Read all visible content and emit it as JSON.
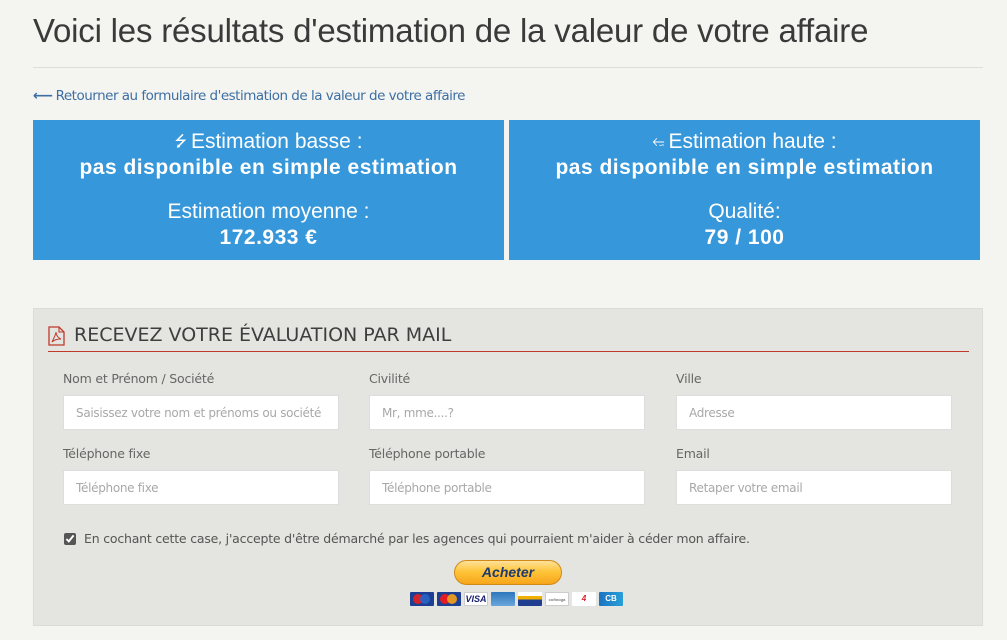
{
  "header": {
    "title": "Voici les résultats d'estimation de la valeur de votre affaire",
    "back_link": "Retourner au formulaire d'estimation de la valeur de votre affaire",
    "back_icon": "long-arrow-left-icon"
  },
  "estimates": {
    "low": {
      "icon": "double-chevron-down-icon",
      "label": "Estimation basse :",
      "value": "pas disponible en simple estimation"
    },
    "high": {
      "icon": "double-chevron-up-icon",
      "label": "Estimation haute :",
      "value": "pas disponible en simple estimation"
    },
    "average": {
      "label": "Estimation moyenne :",
      "value": "172.933 €"
    },
    "quality": {
      "label": "Qualité:",
      "value": "79 / 100"
    },
    "box_color": "#3697da"
  },
  "mail_form": {
    "icon": "pdf-file-icon",
    "title": "RECEVEZ VOTRE ÉVALUATION PAR MAIL",
    "accent_color": "#c0392b",
    "fields": [
      {
        "label": "Nom et Prénom / Société",
        "placeholder": "Saisissez votre nom et prénoms ou société",
        "value": ""
      },
      {
        "label": "Civilité",
        "placeholder": "Mr, mme....?",
        "value": ""
      },
      {
        "label": "Ville",
        "placeholder": "Adresse",
        "value": ""
      },
      {
        "label": "Téléphone fixe",
        "placeholder": "Téléphone fixe",
        "value": ""
      },
      {
        "label": "Téléphone portable",
        "placeholder": "Téléphone portable",
        "value": ""
      },
      {
        "label": "Email",
        "placeholder": "Retaper votre email",
        "value": ""
      }
    ],
    "consent": {
      "checked": true,
      "text": "En cochant cette case, j'accepte d'être démarché par les agences qui pourraient m'aider à céder mon affaire."
    },
    "buy_button": "Acheter",
    "payment_cards": [
      {
        "name": "maestro",
        "label": ""
      },
      {
        "name": "mastercard",
        "label": ""
      },
      {
        "name": "visa",
        "label": "VISA"
      },
      {
        "name": "amex",
        "label": ""
      },
      {
        "name": "aurore",
        "label": ""
      },
      {
        "name": "cofinoga",
        "label": "cofinoga"
      },
      {
        "name": "4-etoiles",
        "label": "4"
      },
      {
        "name": "cb",
        "label": "CB"
      }
    ]
  }
}
